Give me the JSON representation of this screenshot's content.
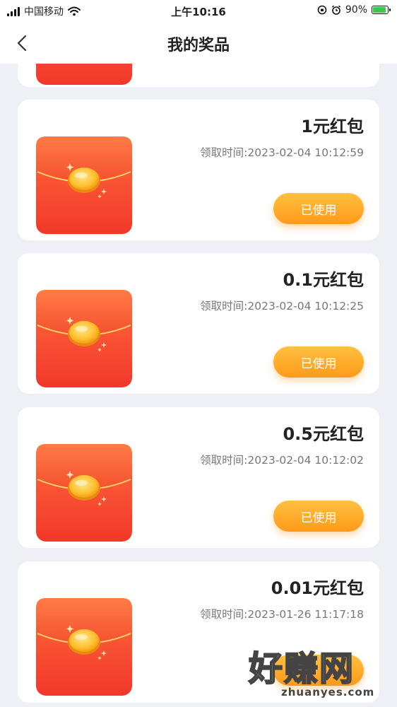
{
  "status_bar": {
    "carrier": "中国移动",
    "time": "上午10:16",
    "battery_percent": "90%",
    "battery_level": 0.9
  },
  "nav": {
    "title": "我的奖品",
    "back_icon": "chevron-left-icon"
  },
  "prizes": [
    {
      "name": "1元红包",
      "claim_time": "领取时间:2023-02-04 10:12:59",
      "button_label": "已使用"
    },
    {
      "name": "0.1元红包",
      "claim_time": "领取时间:2023-02-04 10:12:25",
      "button_label": "已使用"
    },
    {
      "name": "0.5元红包",
      "claim_time": "领取时间:2023-02-04 10:12:02",
      "button_label": "已使用"
    },
    {
      "name": "0.01元红包",
      "claim_time": "领取时间:2023-01-26 11:17:18",
      "button_label": ""
    }
  ],
  "watermark": {
    "main": "好赚网",
    "sub": "zhuanyes.com"
  },
  "colors": {
    "button_gradient_top": "#ffc040",
    "button_gradient_bottom": "#ff9a1a",
    "envelope_red": "#f5452f",
    "background": "#eef0f5"
  }
}
